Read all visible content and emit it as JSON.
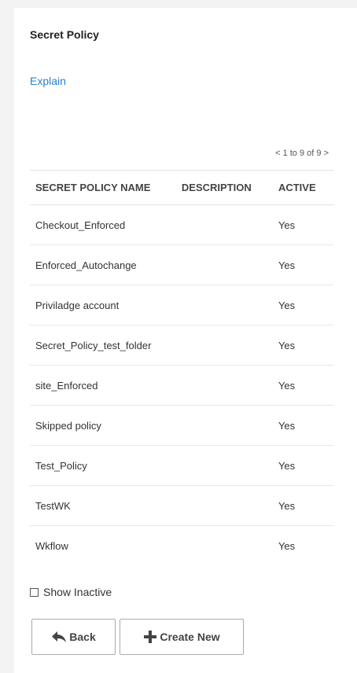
{
  "panel": {
    "title": "Secret Policy",
    "explain_link": "Explain"
  },
  "pager": {
    "prev": "<",
    "range": "1 to 9 of 9",
    "next": ">"
  },
  "table": {
    "headers": {
      "name": "SECRET POLICY NAME",
      "description": "DESCRIPTION",
      "active": "ACTIVE"
    },
    "rows": [
      {
        "name": "Checkout_Enforced",
        "description": "",
        "active": "Yes"
      },
      {
        "name": "Enforced_Autochange",
        "description": "",
        "active": "Yes"
      },
      {
        "name": "Priviladge account",
        "description": "",
        "active": "Yes"
      },
      {
        "name": "Secret_Policy_test_folder",
        "description": "",
        "active": "Yes"
      },
      {
        "name": "site_Enforced",
        "description": "",
        "active": "Yes"
      },
      {
        "name": "Skipped policy",
        "description": "",
        "active": "Yes"
      },
      {
        "name": "Test_Policy",
        "description": "",
        "active": "Yes"
      },
      {
        "name": "TestWK",
        "description": "",
        "active": "Yes"
      },
      {
        "name": "Wkflow",
        "description": "",
        "active": "Yes"
      }
    ]
  },
  "show_inactive": {
    "label": "Show Inactive",
    "checked": false
  },
  "buttons": {
    "back": {
      "label": "Back",
      "icon": "reply-arrow-icon"
    },
    "create": {
      "label": "Create New",
      "icon": "plus-icon"
    }
  },
  "colors": {
    "link": "#2a7fcf",
    "background": "#f3f3f3",
    "panel": "#ffffff"
  }
}
